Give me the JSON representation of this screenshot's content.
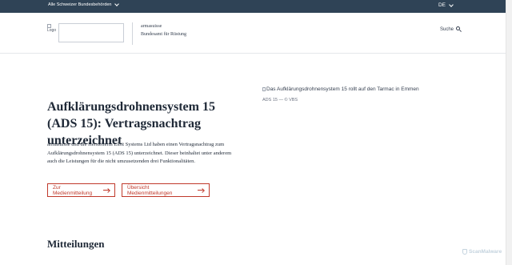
{
  "topbar": {
    "federal_label": "Alle Schweizer Bundesbehörden",
    "language": "DE"
  },
  "header": {
    "logo_alt": "Logo",
    "org_name": "armasuisse",
    "org_subtitle": "Bundesamt für Rüstung",
    "search_label": "Suche"
  },
  "hero": {
    "title": "Aufklärungsdrohnensystem 15 (ADS 15): Vertragsnachtrag unterzeichnet",
    "lead": "armasuisse und die Herstellerin Elbit Systems Ltd haben einen Vertragsnachtrag zum Aufklärungsdrohnensystem 15 (ADS 15) unterzeichnet. Dieser beinhaltet unter anderem auch die Leistungen für die nicht umzusetzenden drei Funktionalitäten.",
    "button_press_release": "Zur Medienmitteilung",
    "button_overview": "Übersicht Medienmitteilungen",
    "image_alt": "Das Aufklärungsdrohnensystem 15 rollt auf den Tarmac in Emmen",
    "image_caption": "ADS 15 — © VBS"
  },
  "section": {
    "title": "Mitteilungen"
  },
  "watermark": {
    "text": "ScanMalware"
  }
}
